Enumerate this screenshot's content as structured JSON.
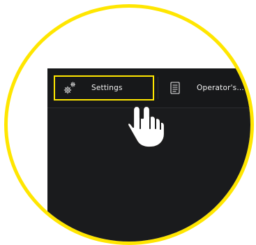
{
  "topbar": {
    "tabs": [
      {
        "label": "Settings",
        "icon": "gears-icon",
        "selected": true
      },
      {
        "label": "Operator's...",
        "icon": "document-icon",
        "selected": false
      }
    ]
  },
  "overlay": {
    "pointer_icon": "hand-pointer-icon"
  },
  "colors": {
    "highlight": "#ffe600",
    "screen_bg": "#1a1b1d",
    "topbar_bg": "#17181a",
    "text": "#f2f2f2"
  }
}
